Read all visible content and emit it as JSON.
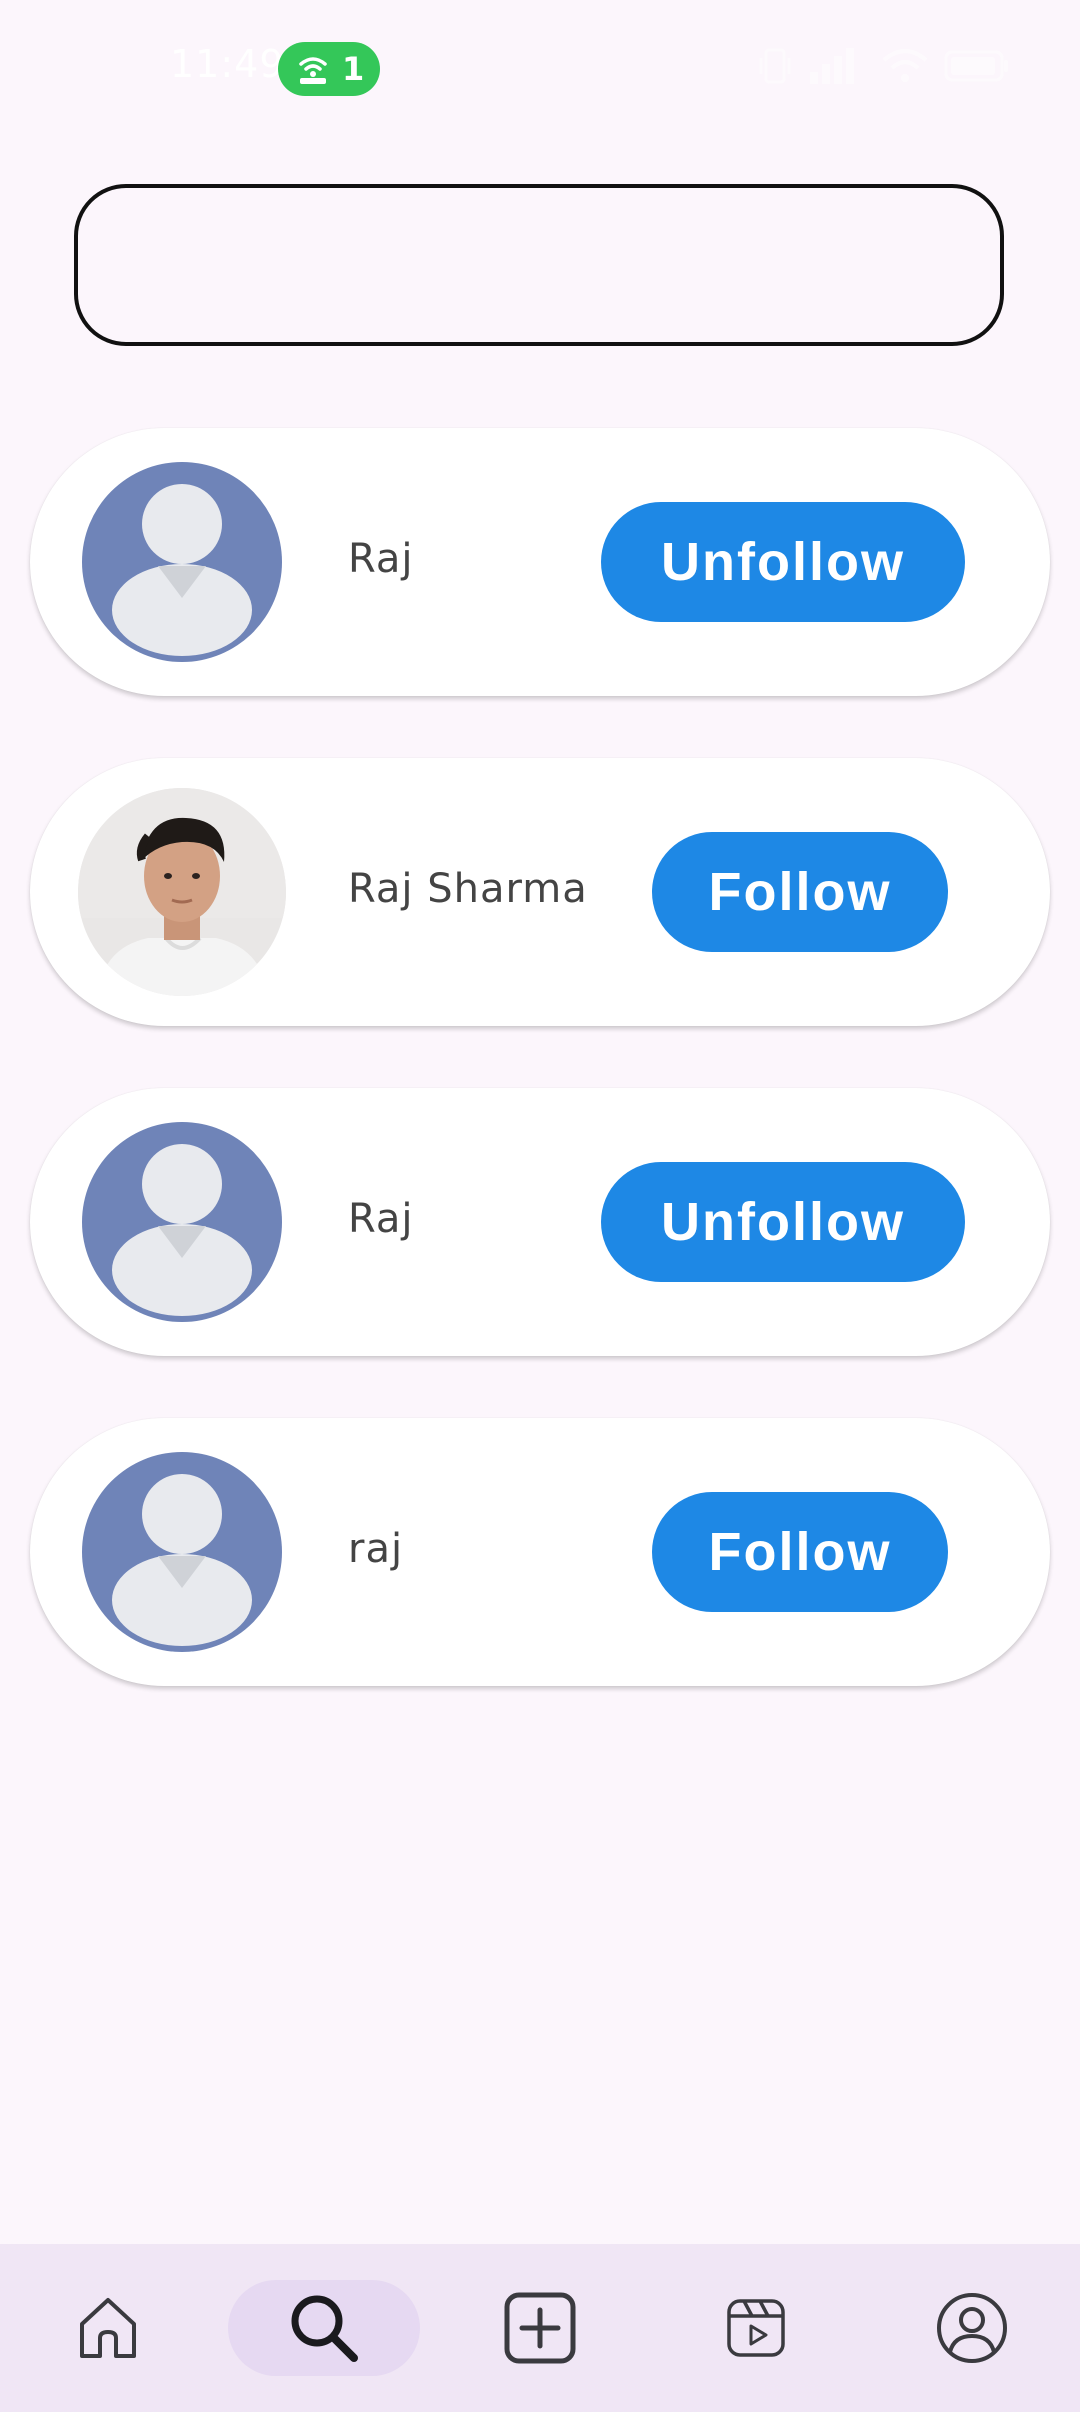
{
  "status_bar": {
    "time": "11:49",
    "hotspot_count": "1",
    "icons": [
      "hotspot-icon",
      "vibrate-icon",
      "signal-icon",
      "wifi-icon",
      "battery-icon"
    ]
  },
  "search": {
    "value": "",
    "placeholder": ""
  },
  "users": [
    {
      "name": "Raj",
      "button": "Unfollow",
      "avatar": "default-avatar-icon"
    },
    {
      "name": "Raj Sharma",
      "button": "Follow",
      "avatar": "profile-photo"
    },
    {
      "name": "Raj",
      "button": "Unfollow",
      "avatar": "default-avatar-icon"
    },
    {
      "name": "raj",
      "button": "Follow",
      "avatar": "default-avatar-icon"
    }
  ],
  "bottom_nav": {
    "items": [
      "home-icon",
      "search-icon",
      "add-post-icon",
      "reels-icon",
      "profile-icon"
    ],
    "active": "search-icon"
  },
  "colors": {
    "background": "#fcf6fc",
    "button_blue": "#1e88e5",
    "avatar_bg": "#6f84b8",
    "nav_bg": "#f0e6f5",
    "nav_active": "#e6d9f2",
    "hotspot_green": "#34c759"
  }
}
